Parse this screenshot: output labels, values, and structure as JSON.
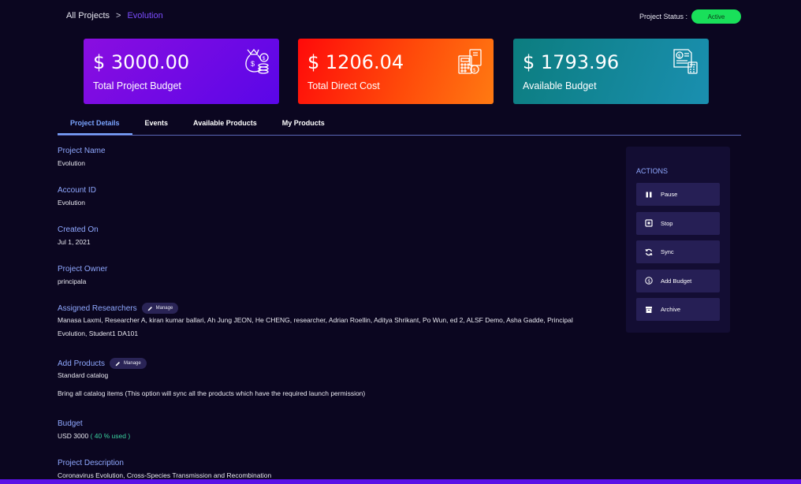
{
  "breadcrumb": {
    "root": "All Projects",
    "separator": ">",
    "current": "Evolution"
  },
  "status": {
    "label": "Project Status :",
    "value": "Active",
    "color": "#19e05a"
  },
  "cards": [
    {
      "amount": "$ 3000.00",
      "label": "Total Project Budget",
      "icon": "money-bag-icon"
    },
    {
      "amount": "$ 1206.04",
      "label": "Total Direct Cost",
      "icon": "calculator-money-icon"
    },
    {
      "amount": "$ 1793.96",
      "label": "Available Budget",
      "icon": "budget-sheet-icon"
    }
  ],
  "tabs": [
    "Project Details",
    "Events",
    "Available Products",
    "My Products"
  ],
  "fields": {
    "project_name": {
      "label": "Project Name",
      "value": "Evolution"
    },
    "account_id": {
      "label": "Account ID",
      "value": "Evolution"
    },
    "created_on": {
      "label": "Created On",
      "value": "Jul 1, 2021"
    },
    "project_owner": {
      "label": "Project Owner",
      "value": "principala"
    },
    "researchers": {
      "label": "Assigned Researchers",
      "manage": "Manage",
      "value": "Manasa Laxmi, Researcher A, kiran kumar ballari, Ah Jung JEON, He CHENG, researcher, Adrian Roellin, Aditya Shrikant, Po Wun, ed 2, ALSF Demo, Asha Gadde, Principal Evolution, Student1 DA101"
    },
    "add_products": {
      "label": "Add Products",
      "manage": "Manage",
      "value": "Standard catalog",
      "note": "Bring all catalog items (This option will sync all the products which have the required launch permission)"
    },
    "budget": {
      "label": "Budget",
      "value": "USD 3000",
      "used": "( 40 % used )"
    },
    "description": {
      "label": "Project Description",
      "value": "Coronavirus Evolution, Cross-Species Transmission and Recombination"
    }
  },
  "actions": {
    "title": "ACTIONS",
    "items": [
      {
        "label": "Pause",
        "icon": "pause-icon"
      },
      {
        "label": "Stop",
        "icon": "stop-icon"
      },
      {
        "label": "Sync",
        "icon": "sync-icon"
      },
      {
        "label": "Add Budget",
        "icon": "dollar-circle-icon"
      },
      {
        "label": "Archive",
        "icon": "archive-icon"
      }
    ]
  },
  "colors": {
    "background": "#0b0620",
    "accent": "#7c4dff",
    "label": "#8fa8ff",
    "used": "#3ad29f"
  }
}
